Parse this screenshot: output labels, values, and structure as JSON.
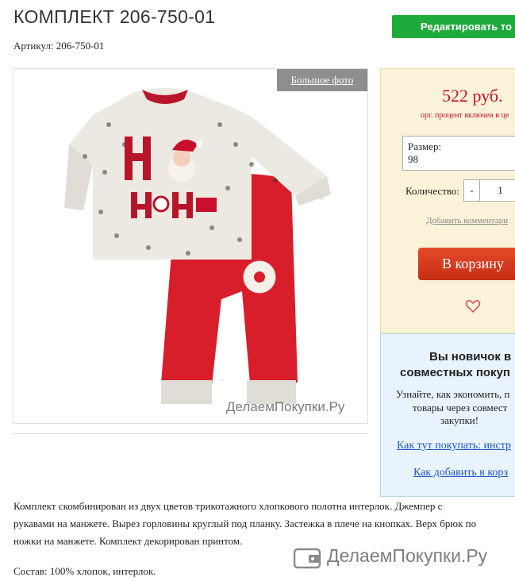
{
  "product": {
    "title": "КОМПЛЕКТ 206-750-01",
    "sku_line": "Артикул: 206-750-01",
    "big_photo_label": "Большое фото",
    "watermark": "ДелаемПокупки.Ру"
  },
  "toolbar": {
    "edit_label": "Редактировать то"
  },
  "purchase": {
    "price": "522 руб.",
    "price_note": "орг. процент включен в це",
    "size_label": "Размер:",
    "size_value": "98",
    "qty_label": "Количество:",
    "qty_minus": "-",
    "qty_value": "1",
    "add_comment": "Добавить комментари",
    "cart_label": "В корзину",
    "heart_icon": "heart-icon"
  },
  "newbie": {
    "title_line1": "Вы новичок в",
    "title_line2": "совместных покуп",
    "text_line1": "Узнайте, как экономить, п",
    "text_line2": "товары через совмест",
    "text_line3": "закупки!",
    "how_buy_link": "Как тут покупать: инстр",
    "how_add_link": "Как добавить в корз"
  },
  "description": {
    "line1": "Комплект скомбинирован из двух цветов трикотажного хлопкового полотна интерлок. Джемпер с",
    "line2": "рукавами на манжете. Вырез горловины круглый под планку. Застежка в плече на кнопках. Верх брюк по",
    "line3": "ножки на манжете. Комплект декорирован принтом.",
    "composition": "Состав: 100% хлопок, интерлок."
  },
  "footer": {
    "brand": "ДелаемПокупки.Ру",
    "icon": "wallet-icon"
  },
  "colors": {
    "edit_green": "#1faa3c",
    "price_red": "#c8102e",
    "cart_red": "#d8391c",
    "link_blue": "#1a56c4",
    "side_yellow": "#fbf3d9",
    "info_blue": "#e8f3fd"
  }
}
